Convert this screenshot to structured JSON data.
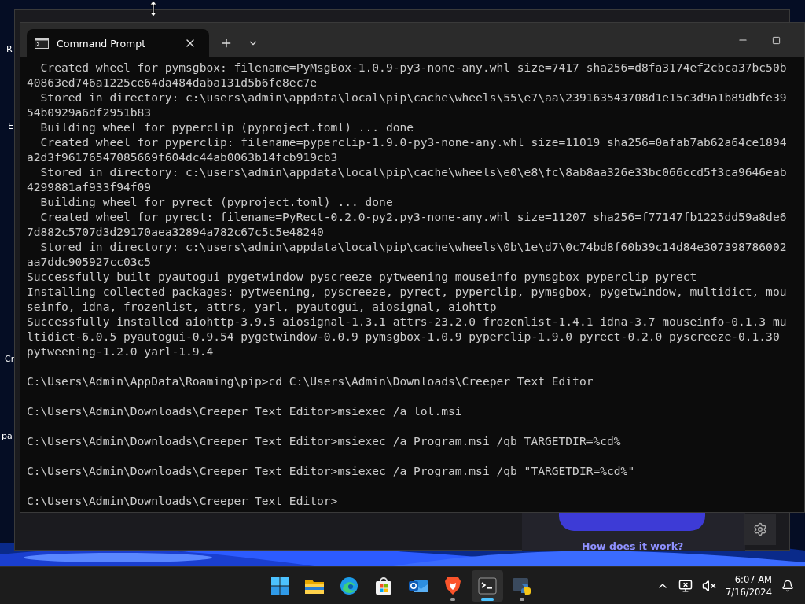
{
  "desktop_labels": [
    "R",
    "E",
    "Cr",
    "pa"
  ],
  "browser": {
    "help_link": "How does it work?"
  },
  "terminal": {
    "tab_title": "Command Prompt",
    "blocks": [
      [
        "  Created wheel for pymsgbox: filename=PyMsgBox-1.0.9-py3-none-any.whl size=7417 sha256=d8fa3174ef2cbca37bc50b",
        "40863ed746a1225ce64da484daba131d5b6fe8ec7e",
        "  Stored in directory: c:\\users\\admin\\appdata\\local\\pip\\cache\\wheels\\55\\e7\\aa\\239163543708d1e15c3d9a1b89dbfe39",
        "54b0929a6df2951b83",
        "  Building wheel for pyperclip (pyproject.toml) ... done",
        "  Created wheel for pyperclip: filename=pyperclip-1.9.0-py3-none-any.whl size=11019 sha256=0afab7ab62a64ce1894",
        "a2d3f96176547085669f604dc44ab0063b14fcb919cb3",
        "  Stored in directory: c:\\users\\admin\\appdata\\local\\pip\\cache\\wheels\\e0\\e8\\fc\\8ab8aa326e33bc066ccd5f3ca9646eab",
        "4299881af933f94f09",
        "  Building wheel for pyrect (pyproject.toml) ... done",
        "  Created wheel for pyrect: filename=PyRect-0.2.0-py2.py3-none-any.whl size=11207 sha256=f77147fb1225dd59a8de6",
        "7d882c5707d3d29170aea32894a782c67c5c5e48240",
        "  Stored in directory: c:\\users\\admin\\appdata\\local\\pip\\cache\\wheels\\0b\\1e\\d7\\0c74bd8f60b39c14d84e307398786002",
        "aa7ddc905927cc03c5",
        "Successfully built pyautogui pygetwindow pyscreeze pytweening mouseinfo pymsgbox pyperclip pyrect",
        "Installing collected packages: pytweening, pyscreeze, pyrect, pyperclip, pymsgbox, pygetwindow, multidict, mou",
        "seinfo, idna, frozenlist, attrs, yarl, pyautogui, aiosignal, aiohttp",
        "Successfully installed aiohttp-3.9.5 aiosignal-1.3.1 attrs-23.2.0 frozenlist-1.4.1 idna-3.7 mouseinfo-0.1.3 mu",
        "ltidict-6.0.5 pyautogui-0.9.54 pygetwindow-0.0.9 pymsgbox-1.0.9 pyperclip-1.9.0 pyrect-0.2.0 pyscreeze-0.1.30",
        "pytweening-1.2.0 yarl-1.9.4"
      ],
      [
        "C:\\Users\\Admin\\AppData\\Roaming\\pip>cd C:\\Users\\Admin\\Downloads\\Creeper Text Editor"
      ],
      [
        "C:\\Users\\Admin\\Downloads\\Creeper Text Editor>msiexec /a lol.msi"
      ],
      [
        "C:\\Users\\Admin\\Downloads\\Creeper Text Editor>msiexec /a Program.msi /qb TARGETDIR=%cd%"
      ],
      [
        "C:\\Users\\Admin\\Downloads\\Creeper Text Editor>msiexec /a Program.msi /qb \"TARGETDIR=%cd%\""
      ],
      [
        "C:\\Users\\Admin\\Downloads\\Creeper Text Editor>"
      ]
    ]
  },
  "taskbar": {
    "apps": [
      {
        "kind": "start",
        "selected": false
      },
      {
        "kind": "explorer",
        "selected": false
      },
      {
        "kind": "edge",
        "selected": false
      },
      {
        "kind": "store",
        "selected": false
      },
      {
        "kind": "outlook",
        "selected": false
      },
      {
        "kind": "brave",
        "selected": false
      },
      {
        "kind": "terminal",
        "selected": true
      },
      {
        "kind": "python",
        "selected": false
      }
    ],
    "time": "6:07 AM",
    "date": "7/16/2024"
  }
}
